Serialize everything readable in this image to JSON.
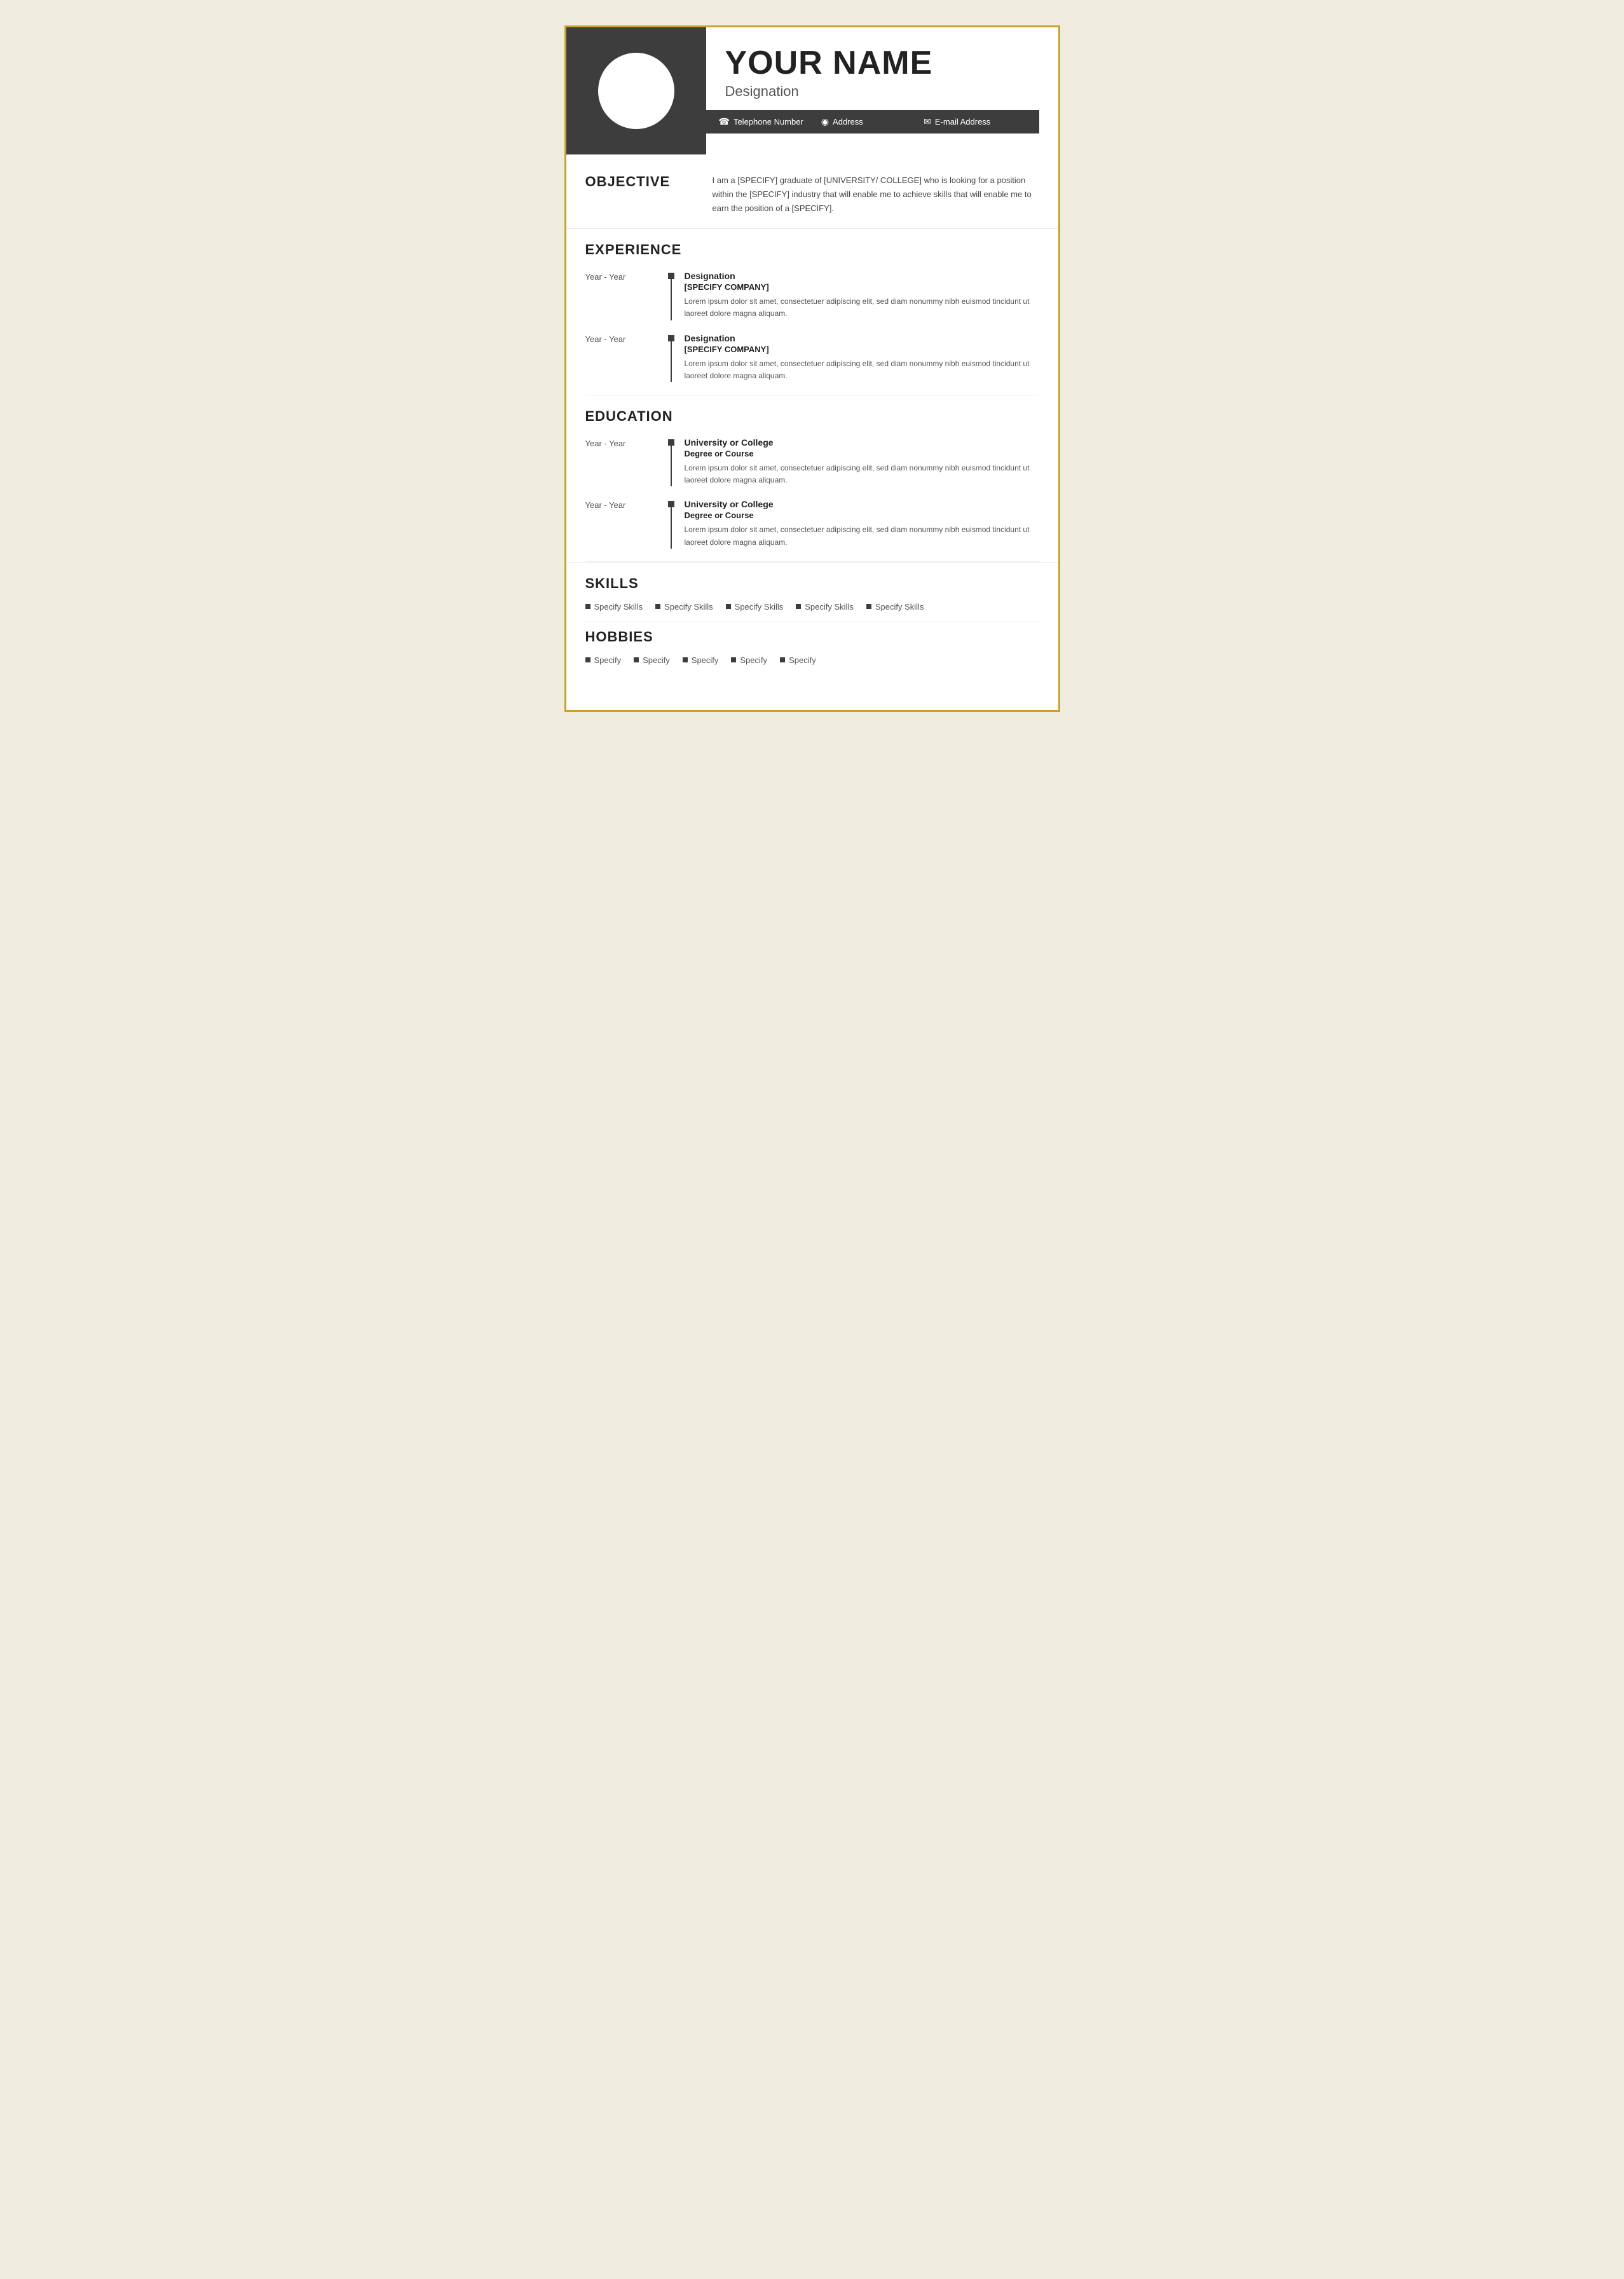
{
  "header": {
    "name": "YOUR NAME",
    "designation": "Designation",
    "contact": {
      "phone_icon": "☎",
      "phone": "Telephone Number",
      "address_icon": "📍",
      "address": "Address",
      "email_icon": "✉",
      "email": "E-mail Address"
    }
  },
  "objective": {
    "title": "OBJECTIVE",
    "text": "I am a [SPECIFY] graduate of [UNIVERSITY/ COLLEGE] who is looking for a position within the [SPECIFY] industry that will enable me to achieve skills that will enable me to earn the position of a [SPECIFY]."
  },
  "experience": {
    "title": "EXPERIENCE",
    "entries": [
      {
        "years": "Year - Year",
        "title": "Designation",
        "company": "[SPECIFY COMPANY]",
        "description": "Lorem ipsum dolor sit amet, consectetuer adipiscing elit, sed diam nonummy nibh euismod tincidunt ut laoreet dolore magna aliquam."
      },
      {
        "years": "Year - Year",
        "title": "Designation",
        "company": "[SPECIFY COMPANY]",
        "description": "Lorem ipsum dolor sit amet, consectetuer adipiscing elit, sed diam nonummy nibh euismod tincidunt ut laoreet dolore magna aliquam."
      }
    ]
  },
  "education": {
    "title": "EDUCATION",
    "entries": [
      {
        "years": "Year - Year",
        "title": "University or College",
        "degree": "Degree or Course",
        "description": "Lorem ipsum dolor sit amet, consectetuer adipiscing elit, sed diam nonummy nibh euismod tincidunt ut laoreet dolore magna aliquam."
      },
      {
        "years": "Year - Year",
        "title": "University or College",
        "degree": "Degree or Course",
        "description": "Lorem ipsum dolor sit amet, consectetuer adipiscing elit, sed diam nonummy nibh euismod tincidunt ut laoreet dolore magna aliquam."
      }
    ]
  },
  "skills": {
    "title": "SKILLS",
    "items": [
      "Specify Skills",
      "Specify Skills",
      "Specify Skills",
      "Specify Skills",
      "Specify Skills"
    ]
  },
  "hobbies": {
    "title": "HOBBIES",
    "items": [
      "Specify",
      "Specify",
      "Specify",
      "Specify",
      "Specify"
    ]
  },
  "colors": {
    "dark": "#3d3d3d",
    "accent": "#c9a227",
    "text_dark": "#222222",
    "text_mid": "#555555",
    "bg_page": "#f0ede0"
  }
}
